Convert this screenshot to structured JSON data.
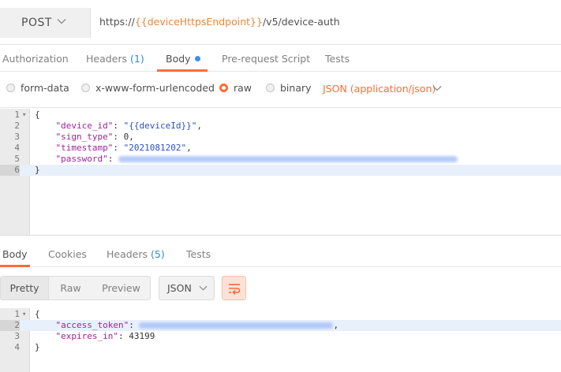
{
  "request": {
    "method": "POST",
    "url_prefix": "https://",
    "url_variable": "{{deviceHttpsEndpoint}}",
    "url_suffix": "/v5/device-auth"
  },
  "request_tabs": [
    {
      "label": "Authorization"
    },
    {
      "label": "Headers",
      "count": "(1)"
    },
    {
      "label": "Body"
    },
    {
      "label": "Pre-request Script"
    },
    {
      "label": "Tests"
    }
  ],
  "body_types": {
    "form_data": "form-data",
    "urlencoded": "x-www-form-urlencoded",
    "raw": "raw",
    "binary": "binary",
    "selected": "raw",
    "content_type": "JSON (application/json)"
  },
  "request_body": {
    "line_numbers": [
      "1",
      "2",
      "3",
      "4",
      "5",
      "6"
    ],
    "open_brace": "{",
    "close_brace": "}",
    "device_id_key": "\"device_id\"",
    "device_id_value": "\"{{deviceId}}\"",
    "sign_type_key": "\"sign_type\"",
    "sign_type_value": "0",
    "timestamp_key": "\"timestamp\"",
    "timestamp_value": "\"2021081202\"",
    "password_key": "\"password\""
  },
  "response_tabs": [
    {
      "label": "Body"
    },
    {
      "label": "Cookies"
    },
    {
      "label": "Headers",
      "count": "(5)"
    },
    {
      "label": "Tests"
    }
  ],
  "response_toolbar": {
    "views": [
      "Pretty",
      "Raw",
      "Preview"
    ],
    "active_view": "Pretty",
    "format": "JSON"
  },
  "response_body": {
    "line_numbers": [
      "1",
      "2",
      "3",
      "4"
    ],
    "open_brace": "{",
    "close_brace": "}",
    "access_token_key": "\"access_token\"",
    "expires_in_key": "\"expires_in\"",
    "expires_in_value": "43199"
  },
  "colors": {
    "accent": "#ff6c37",
    "variable": "#e8873a",
    "count": "#2e8bd8",
    "json_key": "#a0229c",
    "json_string": "#2d4fc5"
  }
}
